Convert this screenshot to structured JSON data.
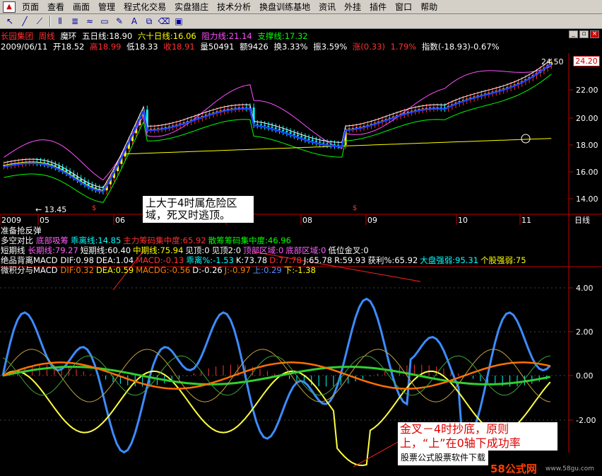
{
  "menu": [
    "页面",
    "查看",
    "画面",
    "管理",
    "程式化交易",
    "实盘猎庄",
    "技术分析",
    "换盘训练基地",
    "资讯",
    "外挂",
    "插件",
    "窗口",
    "帮助"
  ],
  "stock_name": "长园集团",
  "period": "周线",
  "indicator_name": "魔环",
  "ma5": "五日线:18.90",
  "ma60": "六十日线:16.06",
  "resistance": "阻力线:21.14",
  "support": "支撑线:17.32",
  "date": "2009/06/11",
  "open": "开18.52",
  "high": "高18.99",
  "low": "低18.33",
  "close": "收18.91",
  "volume": "量50491",
  "amount": "额9426",
  "turnover": "换3.33%",
  "amplitude": "振3.59%",
  "change": "涨(0.33)",
  "change_pct": "1.79%",
  "index": "指数(-18.93)-0.67%",
  "price_axis": [
    "24.20",
    "22.00",
    "20.00",
    "18.00",
    "16.00",
    "14.00"
  ],
  "price_label_hi": "24.50",
  "price_label_lo": "13.45",
  "current_price": "24.20",
  "time_axis": [
    "2009",
    "05",
    "06",
    "07",
    "08",
    "09",
    "10",
    "11"
  ],
  "time_axis_unit": "日线",
  "ind_rows": [
    {
      "label": "准备抢反弹",
      "parts": []
    },
    {
      "label": "多空对比",
      "parts": [
        [
          "底部吸筹",
          "pink"
        ],
        [
          "乖离线:14.85",
          "cyan"
        ],
        [
          "主力筹码集中度:65.92",
          "red"
        ],
        [
          "散筹筹码集中度:46.96",
          "green"
        ]
      ]
    },
    {
      "label": "短期线",
      "parts": [
        [
          "长期线:79.27",
          "pink"
        ],
        [
          "短期线:60.40",
          "white"
        ],
        [
          "中期线:75.94",
          "yellow"
        ],
        [
          "见顶:0",
          "white"
        ],
        [
          "见顶2:0",
          "white"
        ],
        [
          "顶部区域:0",
          "pink"
        ],
        [
          "底部区域:0",
          "pink"
        ],
        [
          "低位金叉:0",
          "white"
        ]
      ]
    },
    {
      "label": "绝品背离MACD",
      "parts": [
        [
          "DIF:0.98",
          "white"
        ],
        [
          "DEA:1.04",
          "white"
        ],
        [
          "MACD:-0.13",
          "red"
        ],
        [
          "乖离%:-1.53",
          "cyan"
        ],
        [
          "K:73.78",
          "white"
        ],
        [
          "D:77.78",
          "red"
        ],
        [
          "J:65.78",
          "white"
        ],
        [
          "R:59.93",
          "white"
        ],
        [
          "获利%:65.92",
          "white"
        ],
        [
          "大盘强弱:95.31",
          "cyan"
        ],
        [
          "个股强弱:75",
          "yellow"
        ]
      ]
    },
    {
      "label": "微积分与MACD",
      "parts": [
        [
          "DIF:0.32",
          "orange"
        ],
        [
          "DEA:0.59",
          "yellow"
        ],
        [
          "MACDG:-0.56",
          "orange"
        ],
        [
          "D:-0.26",
          "white"
        ],
        [
          "J:-0.97",
          "orange"
        ],
        [
          "上:0.29",
          "blue"
        ],
        [
          "下:-1.38",
          "yellow"
        ]
      ]
    }
  ],
  "ind_axis": [
    "4.00",
    "2.00",
    "0.00",
    "-2.00"
  ],
  "annotation_1": "上大于4时属危险区域，死叉时逃顶。",
  "annotation_2": "金叉－4时抄底，原则上，“上”在0轴下成功率",
  "watermark": "股票公式股票软件下载",
  "logo": "58公式网",
  "logo_url": "www.58gu.com",
  "colors": {
    "bg": "#000000",
    "up": "#ff3030",
    "down": "#00ffff",
    "axis": "#c00000"
  }
}
